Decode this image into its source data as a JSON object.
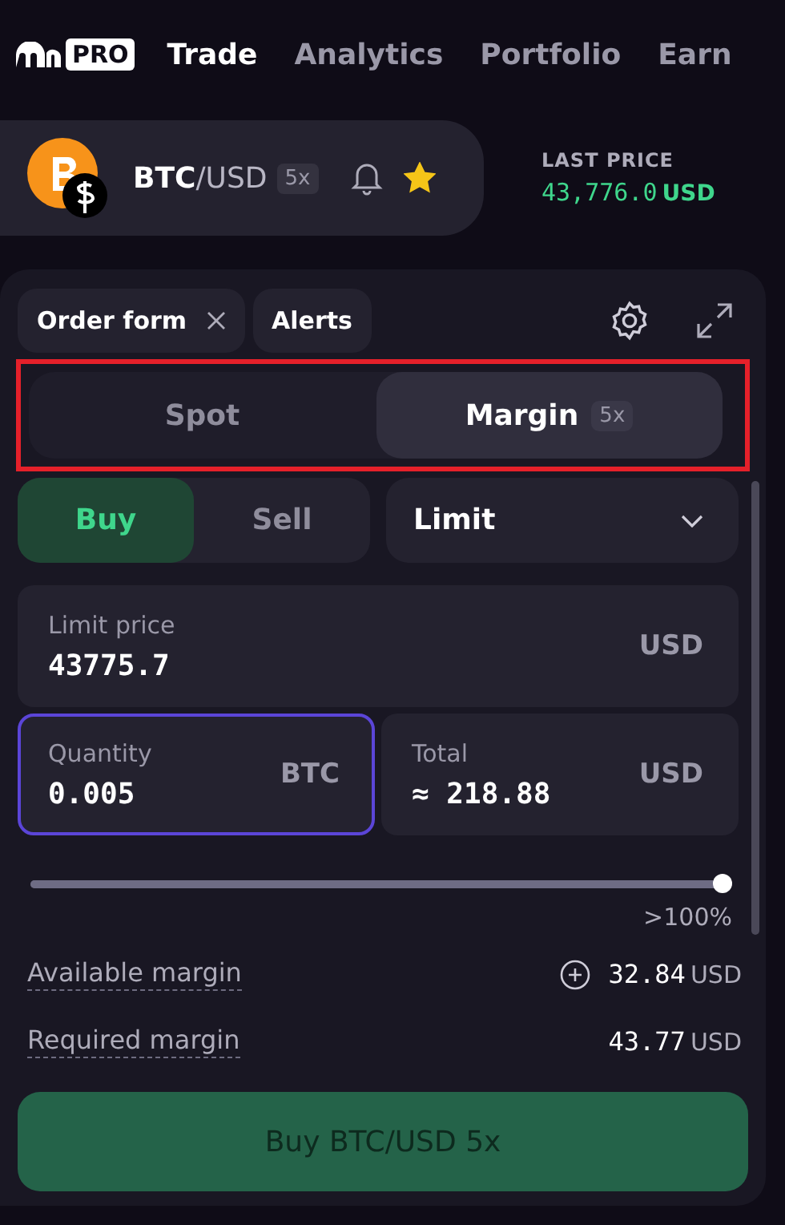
{
  "brand": {
    "badge": "PRO"
  },
  "nav": [
    {
      "label": "Trade",
      "selected": true
    },
    {
      "label": "Analytics",
      "selected": false
    },
    {
      "label": "Portfolio",
      "selected": false
    },
    {
      "label": "Earn",
      "selected": false
    }
  ],
  "pair": {
    "name": "**BTC**/USD",
    "leverage": "5x",
    "favorite": true
  },
  "last_price": {
    "label": "LAST PRICE",
    "value": "43,776.0",
    "currency": "USD"
  },
  "panel_tabs": [
    {
      "label": "Order form",
      "closable": true
    },
    {
      "label": "Alerts",
      "closable": false
    }
  ],
  "mode_toggle": [
    {
      "label": "Spot",
      "selected": false
    },
    {
      "label": "Margin",
      "badge": "5x",
      "selected": true
    }
  ],
  "side": [
    {
      "label": "Buy",
      "selected": true
    },
    {
      "label": "Sell",
      "selected": false
    }
  ],
  "order_type": {
    "value": "Limit"
  },
  "fields": [
    {
      "label": "Limit price",
      "value": "43775.7",
      "unit": "USD",
      "focused": false,
      "wide": true
    },
    {
      "label": "Quantity",
      "value": "0.005",
      "unit": "BTC",
      "focused": true,
      "wide": false
    },
    {
      "label": "Total",
      "value": "≈ 218.88",
      "unit": "USD",
      "focused": false,
      "wide": false
    }
  ],
  "slider": {
    "level": 1.0,
    "reading": ">100%"
  },
  "summary": [
    {
      "label": "Available margin",
      "value": "32.84",
      "unit": "USD",
      "add": true
    },
    {
      "label": "Required margin",
      "value": "43.77",
      "unit": "USD",
      "add": false
    }
  ],
  "submit": {
    "label": "Buy BTC/USD 5x"
  }
}
